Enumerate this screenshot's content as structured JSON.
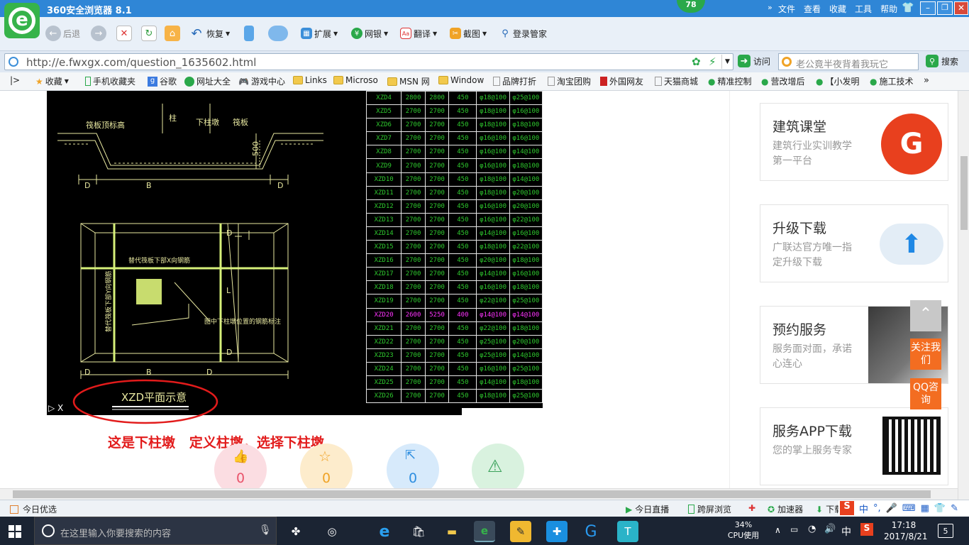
{
  "window": {
    "title": "360安全浏览器 8.1",
    "badge": "78",
    "menu": [
      "文件",
      "查看",
      "收藏",
      "工具",
      "帮助"
    ]
  },
  "toolbar": {
    "back": "后退",
    "restore": "恢复",
    "extend": "扩展",
    "bank": "网银",
    "translate": "翻译",
    "screenshot": "截图",
    "login": "登录管家"
  },
  "address": {
    "url": "http://e.fwxgx.com/question_1635602.html",
    "go": "访问",
    "search_hint": "老公竟半夜背着我玩它",
    "search_btn": "搜索"
  },
  "favorites": [
    "收藏",
    "手机收藏夹",
    "谷歌",
    "网址大全",
    "游戏中心",
    "Links",
    "Microso",
    "MSN 网",
    "Window",
    "品牌打折",
    "淘宝团购",
    "外国网友",
    "天猫商城",
    "精准控制",
    "营改增后",
    "【小发明",
    "施工技术"
  ],
  "cad": {
    "rows": [
      [
        "XZD4",
        "2800",
        "2800",
        "450",
        "φ18@100",
        "φ25@100"
      ],
      [
        "XZD5",
        "2700",
        "2700",
        "450",
        "φ18@100",
        "φ16@100"
      ],
      [
        "XZD6",
        "2700",
        "2700",
        "450",
        "φ18@100",
        "φ18@100"
      ],
      [
        "XZD7",
        "2700",
        "2700",
        "450",
        "φ16@100",
        "φ16@100"
      ],
      [
        "XZD8",
        "2700",
        "2700",
        "450",
        "φ16@100",
        "φ14@100"
      ],
      [
        "XZD9",
        "2700",
        "2700",
        "450",
        "φ16@100",
        "φ18@100"
      ],
      [
        "XZD10",
        "2700",
        "2700",
        "450",
        "φ18@100",
        "φ14@100"
      ],
      [
        "XZD11",
        "2700",
        "2700",
        "450",
        "φ18@100",
        "φ20@100"
      ],
      [
        "XZD12",
        "2700",
        "2700",
        "450",
        "φ16@100",
        "φ20@100"
      ],
      [
        "XZD13",
        "2700",
        "2700",
        "450",
        "φ16@100",
        "φ22@100"
      ],
      [
        "XZD14",
        "2700",
        "2700",
        "450",
        "φ14@100",
        "φ16@100"
      ],
      [
        "XZD15",
        "2700",
        "2700",
        "450",
        "φ18@100",
        "φ22@100"
      ],
      [
        "XZD16",
        "2700",
        "2700",
        "450",
        "φ20@100",
        "φ18@100"
      ],
      [
        "XZD17",
        "2700",
        "2700",
        "450",
        "φ14@100",
        "φ16@100"
      ],
      [
        "XZD18",
        "2700",
        "2700",
        "450",
        "φ16@100",
        "φ18@100"
      ],
      [
        "XZD19",
        "2700",
        "2700",
        "450",
        "φ22@100",
        "φ25@100"
      ],
      [
        "XZD20",
        "2600",
        "5250",
        "400",
        "φ14@100",
        "φ14@100"
      ],
      [
        "XZD21",
        "2700",
        "2700",
        "450",
        "φ22@100",
        "φ18@100"
      ],
      [
        "XZD22",
        "2700",
        "2700",
        "450",
        "φ25@100",
        "φ20@100"
      ],
      [
        "XZD23",
        "2700",
        "2700",
        "450",
        "φ25@100",
        "φ14@100"
      ],
      [
        "XZD24",
        "2700",
        "2700",
        "450",
        "φ16@100",
        "φ25@100"
      ],
      [
        "XZD25",
        "2700",
        "2700",
        "450",
        "φ14@100",
        "φ18@100"
      ],
      [
        "XZD26",
        "2700",
        "2700",
        "450",
        "φ18@100",
        "φ25@100"
      ]
    ],
    "highlight_color": "#ff33ff",
    "labels": {
      "slab_top": "筏板顶标高",
      "column": "柱",
      "lower_pier": "下柱墩",
      "slab": "筏板",
      "dim_d": "D",
      "dim_b": "B",
      "dim_500": "500",
      "replace_x": "替代筏板下部X向钢筋",
      "replace_y": "替代筏板下部Y向钢筋",
      "note": "图中下柱墩位置的钢筋标注",
      "plan_title": "XZD平面示意",
      "dim_l": "L"
    }
  },
  "answer_text": "这是下柱墩   定义柱墩，选择下柱墩",
  "reactions": [
    {
      "name": "like",
      "count": "0",
      "color": "#e9546b",
      "bg": "#fbdde2"
    },
    {
      "name": "star",
      "count": "0",
      "color": "#f0a326",
      "bg": "#fdeccc"
    },
    {
      "name": "share",
      "count": "0",
      "color": "#2f8fe0",
      "bg": "#d7eafb"
    },
    {
      "name": "report",
      "count": "",
      "color": "#3aa15a",
      "bg": "#d9f2df"
    }
  ],
  "sidebar": [
    {
      "title": "建筑课堂",
      "desc": "建筑行业实训教学第一平台",
      "icon": "logo-icon"
    },
    {
      "title": "升级下载",
      "desc": "广联达官方唯一指定升级下载",
      "icon": "cloud-upload-icon"
    },
    {
      "title": "预约服务",
      "desc": "服务面对面，承诺心连心",
      "icon": "handshake-icon"
    },
    {
      "title": "服务APP下载",
      "desc": "您的掌上服务专家",
      "icon": "qr-code-icon"
    }
  ],
  "float": {
    "follow": "关注我们",
    "qq": "QQ咨询"
  },
  "status": {
    "today": "今日优选",
    "live": "今日直播",
    "screen": "跨屏浏览",
    "accel": "加速器",
    "download": "下载"
  },
  "taskbar": {
    "search": "在这里输入你要搜索的内容",
    "cpu_pct": "34%",
    "cpu_label": "CPU使用",
    "ime": "中",
    "time": "17:18",
    "date": "2017/8/21",
    "notif": "5"
  }
}
